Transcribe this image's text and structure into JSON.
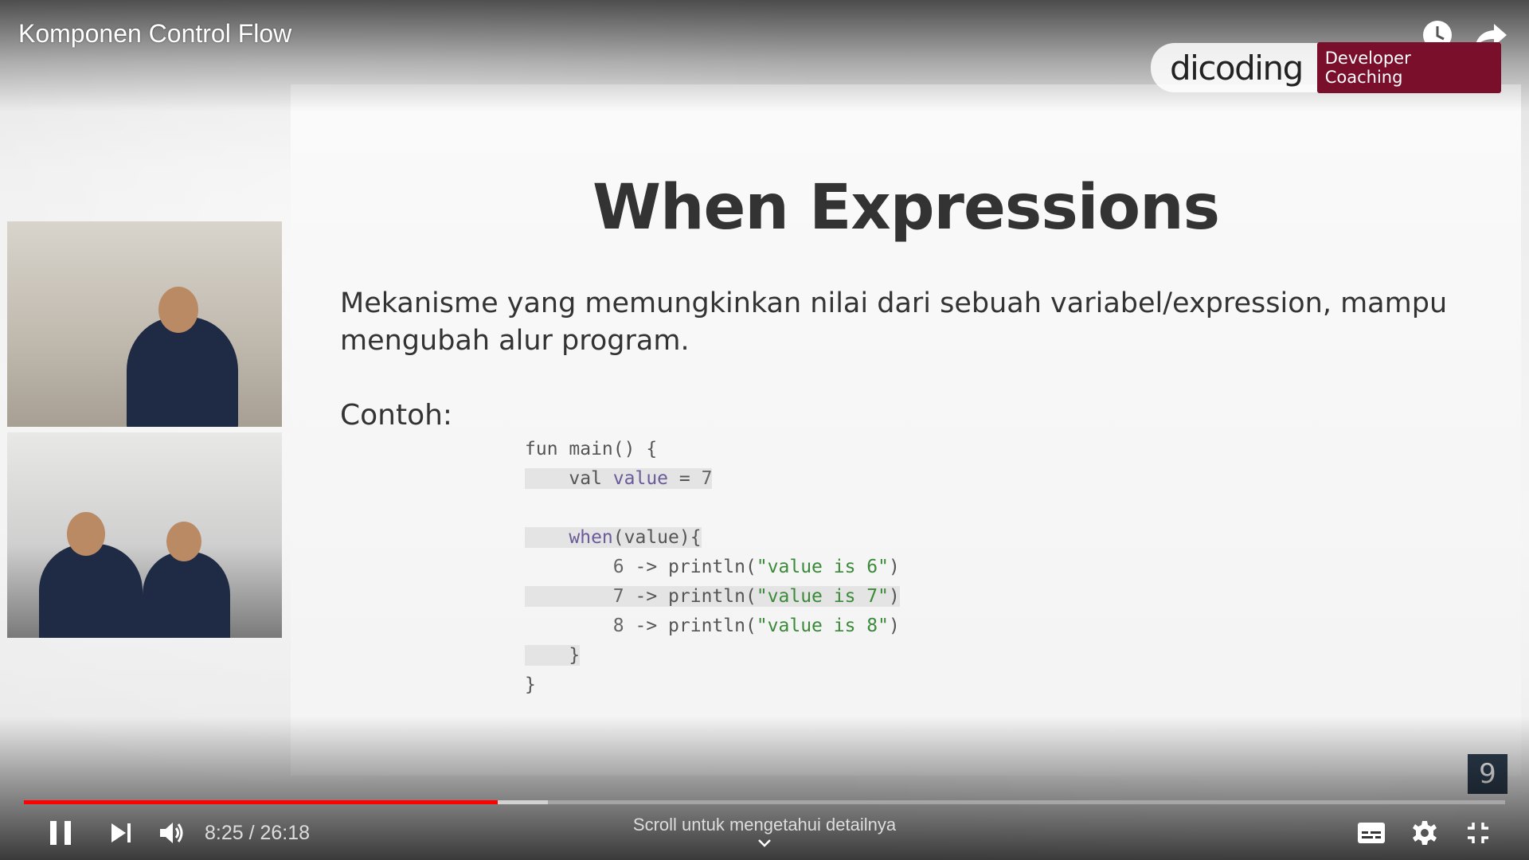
{
  "video": {
    "title": "Komponen Control Flow"
  },
  "brand": {
    "logo_text": "dicoding",
    "badge": "Developer Coaching"
  },
  "slide": {
    "title": "When Expressions",
    "description": "Mekanisme yang memungkinkan nilai dari sebuah variabel/expression, mampu mengubah alur program.",
    "example_label": "Contoh:",
    "code_lines": [
      "fun main() {",
      "    val value = 7",
      "",
      "    when(value){",
      "        6 -> println(\"value is 6\")",
      "        7 -> println(\"value is 7\")",
      "        8 -> println(\"value is 8\")",
      "    }",
      "}"
    ],
    "page_number": "9"
  },
  "player": {
    "current_time": "8:25",
    "duration": "26:18",
    "time_display": "8:25 / 26:18",
    "progress_fraction": 0.32,
    "buffer_fraction": 0.354,
    "scroll_hint": "Scroll untuk mengetahui detailnya",
    "accent_color": "#ff0000"
  },
  "icons": {
    "watch_later": "clock-icon",
    "share": "share-arrow-icon",
    "play_pause": "pause-icon",
    "next": "skip-next-icon",
    "volume": "volume-icon",
    "subtitles": "subtitles-icon",
    "settings": "gear-icon",
    "fullscreen": "exit-fullscreen-icon",
    "scroll": "chevron-down-icon"
  }
}
